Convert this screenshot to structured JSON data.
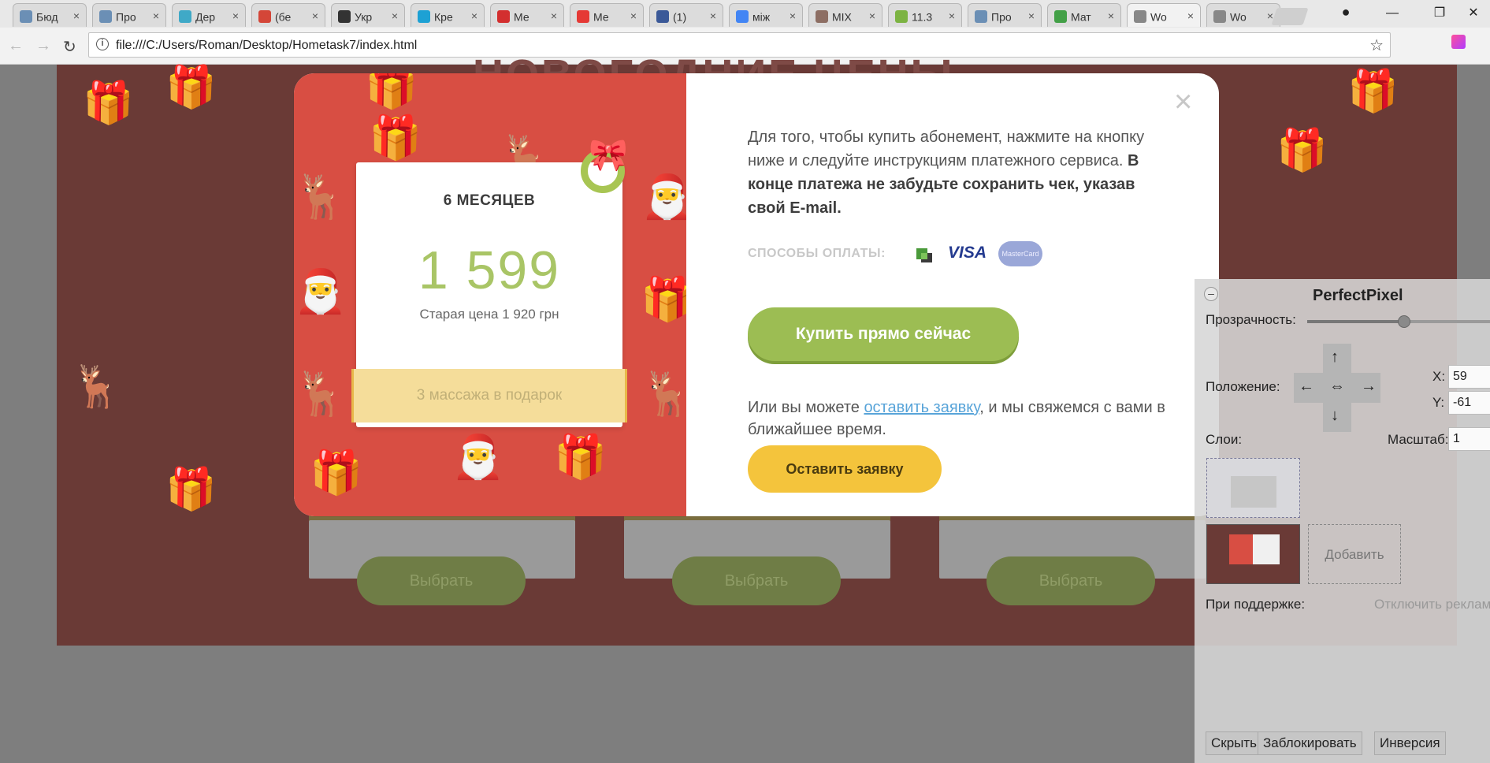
{
  "browser": {
    "tabs": [
      {
        "label": "Бюд",
        "icon": "building-icon",
        "color": "#6b8fb5"
      },
      {
        "label": "Про",
        "icon": "building-icon",
        "color": "#6b8fb5"
      },
      {
        "label": "Дер",
        "icon": "f-script-icon",
        "color": "#3fa9c7"
      },
      {
        "label": "(бе",
        "icon": "gmail-icon",
        "color": "#d44638"
      },
      {
        "label": "Укр",
        "icon": "t-icon",
        "color": "#333333"
      },
      {
        "label": "Кре",
        "icon": "z-icon",
        "color": "#1da1d4"
      },
      {
        "label": "Ме",
        "icon": "k-icon",
        "color": "#d32f2f"
      },
      {
        "label": "Ме",
        "icon": "pdf-icon",
        "color": "#e53935"
      },
      {
        "label": "(1)",
        "icon": "facebook-icon",
        "color": "#3b5998"
      },
      {
        "label": "між",
        "icon": "google-icon",
        "color": "#4285f4"
      },
      {
        "label": "MIX",
        "icon": "notebook-icon",
        "color": "#8d6e63"
      },
      {
        "label": "11.3",
        "icon": "tree-icon",
        "color": "#7cb342"
      },
      {
        "label": "Про",
        "icon": "building-icon",
        "color": "#6b8fb5"
      },
      {
        "label": "Мат",
        "icon": "f-icon",
        "color": "#43a047"
      },
      {
        "label": "Wo",
        "icon": "file-icon",
        "color": "#888888",
        "active": true
      },
      {
        "label": "Wo",
        "icon": "file-icon",
        "color": "#888888"
      }
    ],
    "close_glyph": "×",
    "url": "file:///C:/Users/Roman/Desktop/Hometask7/index.html",
    "window_controls": {
      "minimize": "—",
      "maximize": "❐",
      "close": "✕"
    }
  },
  "page": {
    "bg_title": "НОВОГОДНИЕ ЦЕНЫ",
    "select_buttons": [
      "Выбрать",
      "Выбрать",
      "Выбрать"
    ]
  },
  "modal": {
    "close": "×",
    "price_card": {
      "period": "6 МЕСЯЦЕВ",
      "price": "1 599",
      "old_price": "Старая цена 1 920 грн",
      "gift": "3 массажа в подарок"
    },
    "text_normal": "Для того, чтобы купить абонемент, нажмите на кнопку ниже и следуйте инструкциям платежного сервиса. ",
    "text_bold": "В конце платежа не забудьте сохранить чек, указав свой E-mail.",
    "payment_label": "СПОСОБЫ ОПЛАТЫ:",
    "payment_visa": "VISA",
    "payment_mastercard": "MasterCard",
    "buy_button": "Купить прямо сейчас",
    "or_text_before": "Или вы можете ",
    "or_text_link": "оставить заявку",
    "or_text_after": ", и мы свяжемся с вами в ближайшее время.",
    "request_button": "Оставить заявку"
  },
  "perfectpixel": {
    "title": "PerfectPixel",
    "minimize": "–",
    "opacity_label": "Прозрачность:",
    "opacity_value": 0.53,
    "position_label": "Положение:",
    "arrows": {
      "up": "↑",
      "down": "↓",
      "left": "←",
      "right": "→",
      "center": "⇔"
    },
    "x_label": "X:",
    "x_value": "59",
    "y_label": "Y:",
    "y_value": "-61",
    "scale_label": "Масштаб:",
    "scale_value": "1",
    "layers_label": "Слои:",
    "add_label": "Добавить",
    "support_label": "При поддержке:",
    "ads_label": "Отключить рекламу",
    "hide_button": "Скрыть",
    "lock_button": "Заблокировать",
    "invert_button": "Инверсия"
  }
}
